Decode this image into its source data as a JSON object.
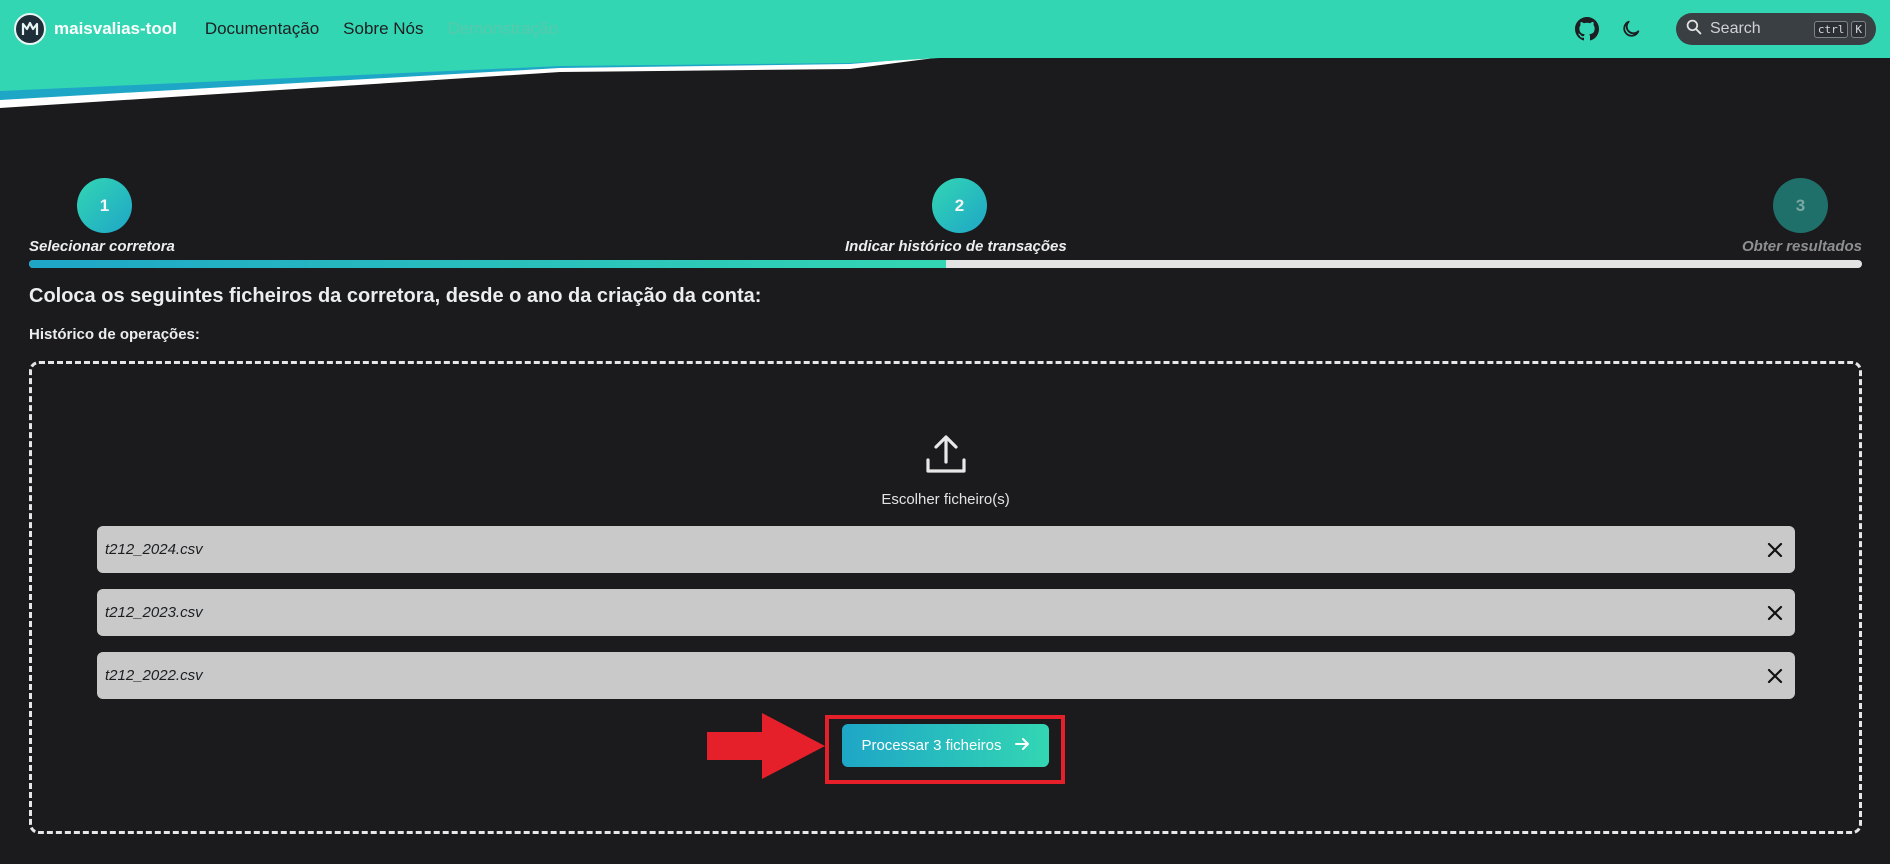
{
  "navbar": {
    "brand": "maisvalias-tool",
    "links": [
      {
        "label": "Documentação",
        "disabled": false
      },
      {
        "label": "Sobre Nós",
        "disabled": false
      },
      {
        "label": "Demonstração",
        "disabled": true
      }
    ],
    "github_icon": "github-icon",
    "theme_icon": "moon-icon",
    "search": {
      "placeholder": "Search",
      "shortcut_keys": [
        "ctrl",
        "K"
      ]
    }
  },
  "stepper": {
    "steps": [
      {
        "number": "1",
        "label": "Selecionar corretora",
        "active": true
      },
      {
        "number": "2",
        "label": "Indicar histórico de transações",
        "active": true
      },
      {
        "number": "3",
        "label": "Obter resultados",
        "active": false
      }
    ],
    "progress_fraction": 0.5
  },
  "content": {
    "heading": "Coloca os seguintes ficheiros da corretora, desde o ano da criação da conta:",
    "subheading": "Histórico de operações:",
    "dropzone": {
      "upload_icon": "upload-icon",
      "upload_label": "Escolher ficheiro(s)"
    },
    "files": [
      {
        "name": "t212_2024.csv"
      },
      {
        "name": "t212_2023.csv"
      },
      {
        "name": "t212_2022.csv"
      }
    ],
    "process_button": {
      "label": "Processar 3 ficheiros",
      "icon": "arrow-right-icon"
    }
  },
  "colors": {
    "accent": "#33d6b3",
    "accent_secondary": "#1ea6c7",
    "background": "#1b1b1d",
    "file_row": "#c9c9c9",
    "annotation": "#e5202a"
  }
}
